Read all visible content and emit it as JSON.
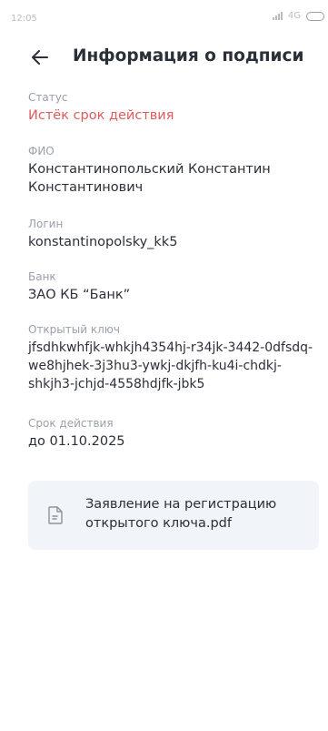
{
  "status_bar": {
    "time": "12:05",
    "network": "4G"
  },
  "header": {
    "title": "Информация о подписи"
  },
  "fields": {
    "status": {
      "label": "Статус",
      "value": "Истёк срок действия"
    },
    "fio": {
      "label": "ФИО",
      "value": "Константинопольский Константин Константинович"
    },
    "login": {
      "label": "Логин",
      "value": "konstantinopolsky_kk5"
    },
    "bank": {
      "label": "Банк",
      "value": "ЗАО КБ “Банк”"
    },
    "public_key": {
      "label": "Открытый ключ",
      "value": "jfsdhkwhfjk-whkjh4354hj-r34jk-3442-0dfsdq-we8hjhek-3j3hu3-ywkj-dkjfh-ku4i-chdkj-shkjh3-jchjd-4558hdjfk-jbk5"
    },
    "validity": {
      "label": "Срок действия",
      "value": "до 01.10.2025"
    }
  },
  "document": {
    "name": "Заявление на регистрацию открытого ключа.pdf",
    "icon": "document-icon"
  },
  "colors": {
    "expired": "#e05a5a",
    "label": "#9aa0aa",
    "card_bg": "#f1f4f8"
  }
}
